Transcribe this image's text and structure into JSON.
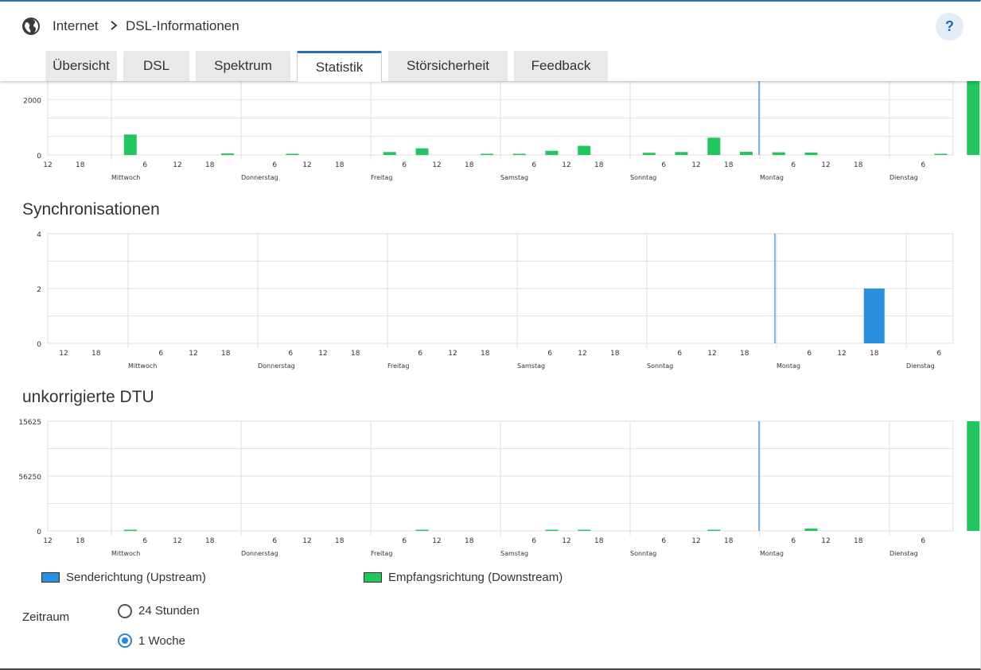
{
  "breadcrumb": {
    "root": "Internet",
    "current": "DSL-Informationen",
    "globe_icon": "globe-icon",
    "sep_icon": "chevron-right-icon"
  },
  "help_label": "?",
  "tabs": [
    {
      "label": "Übersicht",
      "active": false
    },
    {
      "label": "DSL",
      "active": false
    },
    {
      "label": "Spektrum",
      "active": false
    },
    {
      "label": "Statistik",
      "active": true
    },
    {
      "label": "Störsicherheit",
      "active": false
    },
    {
      "label": "Feedback",
      "active": false
    }
  ],
  "colors": {
    "upstream": "#2b8fe0",
    "downstream": "#22c55e",
    "accent": "#2a6fb0",
    "grid": "#dddddd"
  },
  "sections": {
    "sync_title": "Synchronisationen",
    "dtu_title": "unkorrigierte DTU"
  },
  "legend": {
    "upstream": "Senderichtung (Upstream)",
    "downstream": "Empfangsrichtung (Downstream)"
  },
  "timerange": {
    "label": "Zeitraum",
    "options": [
      {
        "label": "24 Stunden",
        "selected": false
      },
      {
        "label": "1 Woche",
        "selected": true
      }
    ]
  },
  "chart_data": [
    {
      "type": "bar",
      "title": "",
      "ylim": [
        0,
        3000
      ],
      "yticks": [
        "2000",
        "0"
      ],
      "tick_hours": [
        "12",
        "18",
        "",
        "6",
        "12",
        "18",
        "",
        "6",
        "12",
        "18",
        "",
        "6",
        "12",
        "18",
        "",
        "6",
        "12",
        "18",
        "",
        "6",
        "12",
        "18",
        "",
        "6",
        "12",
        "18",
        "",
        "6"
      ],
      "day_labels": [
        "Mittwoch",
        "Donnerstag",
        "Freitag",
        "Samstag",
        "Sonntag",
        "Montag",
        "Dienstag"
      ],
      "grid": true,
      "series": [
        {
          "color": "downstream",
          "values": [
            0,
            830,
            0,
            0,
            60,
            0,
            50,
            0,
            0,
            120,
            270,
            0,
            30,
            20,
            170,
            370,
            0,
            90,
            120,
            700,
            130,
            110,
            100,
            0,
            0,
            0,
            30,
            3000,
            0
          ]
        },
        {
          "color": "upstream",
          "values": []
        }
      ]
    },
    {
      "type": "bar",
      "title": "Synchronisationen",
      "ylim": [
        0,
        4
      ],
      "yticks": [
        "4",
        "2",
        "0"
      ],
      "tick_hours": [
        "12",
        "18",
        "",
        "6",
        "12",
        "18",
        "",
        "6",
        "12",
        "18",
        "",
        "6",
        "12",
        "18",
        "",
        "6",
        "12",
        "18",
        "",
        "6",
        "12",
        "18",
        "",
        "6",
        "12",
        "18",
        "",
        "6"
      ],
      "day_labels": [
        "Mittwoch",
        "Donnerstag",
        "Freitag",
        "Samstag",
        "Sonntag",
        "Montag",
        "Dienstag"
      ],
      "grid": true,
      "series": [
        {
          "color": "upstream",
          "values": [
            0,
            0,
            0,
            0,
            0,
            0,
            0,
            0,
            0,
            0,
            0,
            0,
            0,
            0,
            0,
            0,
            0,
            0,
            0,
            0,
            0,
            0,
            0,
            0,
            0,
            2,
            0,
            0
          ]
        }
      ]
    },
    {
      "type": "bar",
      "title": "unkorrigierte DTU",
      "ylim": [
        0,
        115625
      ],
      "yticks": [
        "15625",
        "56250",
        "0"
      ],
      "tick_hours": [
        "12",
        "18",
        "",
        "6",
        "12",
        "18",
        "",
        "6",
        "12",
        "18",
        "",
        "6",
        "12",
        "18",
        "",
        "6",
        "12",
        "18",
        "",
        "6",
        "12",
        "18",
        "",
        "6",
        "12",
        "18",
        "",
        "6"
      ],
      "day_labels": [
        "Mittwoch",
        "Donnerstag",
        "Freitag",
        "Samstag",
        "Sonntag",
        "Montag",
        "Dienstag"
      ],
      "grid": true,
      "series": [
        {
          "color": "downstream",
          "values": [
            0,
            800,
            0,
            0,
            0,
            0,
            0,
            0,
            0,
            0,
            700,
            0,
            0,
            0,
            300,
            500,
            0,
            0,
            0,
            500,
            0,
            0,
            2500,
            0,
            0,
            0,
            0,
            115625,
            0
          ]
        }
      ]
    }
  ]
}
